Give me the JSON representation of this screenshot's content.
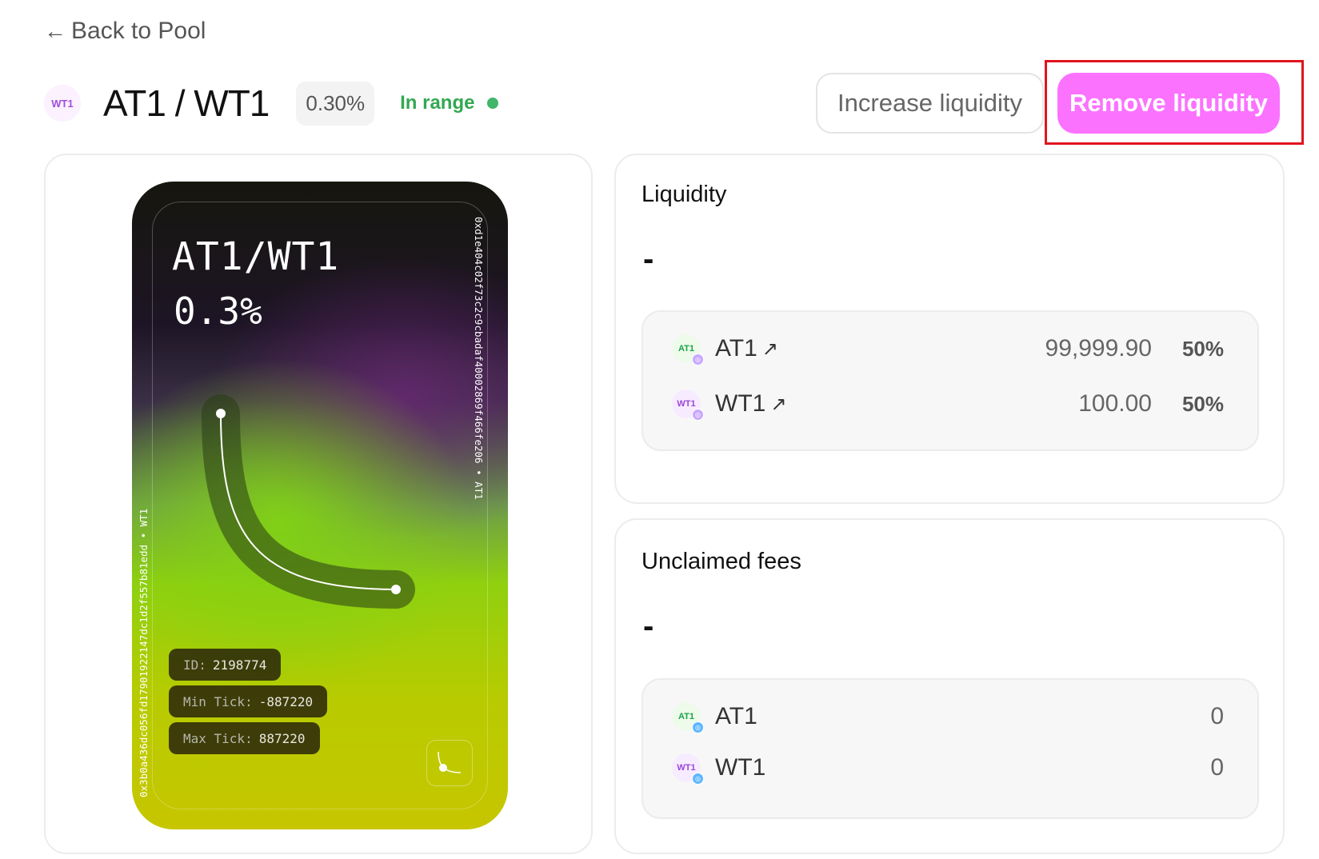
{
  "nav": {
    "back_label": "Back to Pool"
  },
  "header": {
    "pair_icon_text": "WT1",
    "pair_title": "AT1 / WT1",
    "fee_tier": "0.30%",
    "range_status": "In range"
  },
  "actions": {
    "increase_label": "Increase liquidity",
    "remove_label": "Remove liquidity"
  },
  "nft": {
    "pair": "AT1/WT1",
    "fee": "0.3%",
    "left_text": "0x3b0a436dc056fd17901922147dc1d2f557b81edd • WT1",
    "right_text": "0xd1e404c02f73c2c9cbadaf40002869f466fe206 • AT1",
    "id_label": "ID:",
    "id_value": "2198774",
    "min_tick_label": "Min Tick:",
    "min_tick_value": "-887220",
    "max_tick_label": "Max Tick:",
    "max_tick_value": "887220"
  },
  "liquidity": {
    "title": "Liquidity",
    "value": "-",
    "tokens": [
      {
        "icon": "AT1",
        "symbol": "AT1",
        "link_icon": "↗",
        "amount": "99,999.90",
        "percent": "50%"
      },
      {
        "icon": "WT1",
        "symbol": "WT1",
        "link_icon": "↗",
        "amount": "100.00",
        "percent": "50%"
      }
    ]
  },
  "unclaimed_fees": {
    "title": "Unclaimed fees",
    "value": "-",
    "tokens": [
      {
        "icon": "AT1",
        "symbol": "AT1",
        "amount": "0"
      },
      {
        "icon": "WT1",
        "symbol": "WT1",
        "amount": "0"
      }
    ]
  },
  "colors": {
    "accent_pink": "#fb72ff",
    "in_range_green": "#33a852",
    "highlight_red": "#e0141e"
  }
}
